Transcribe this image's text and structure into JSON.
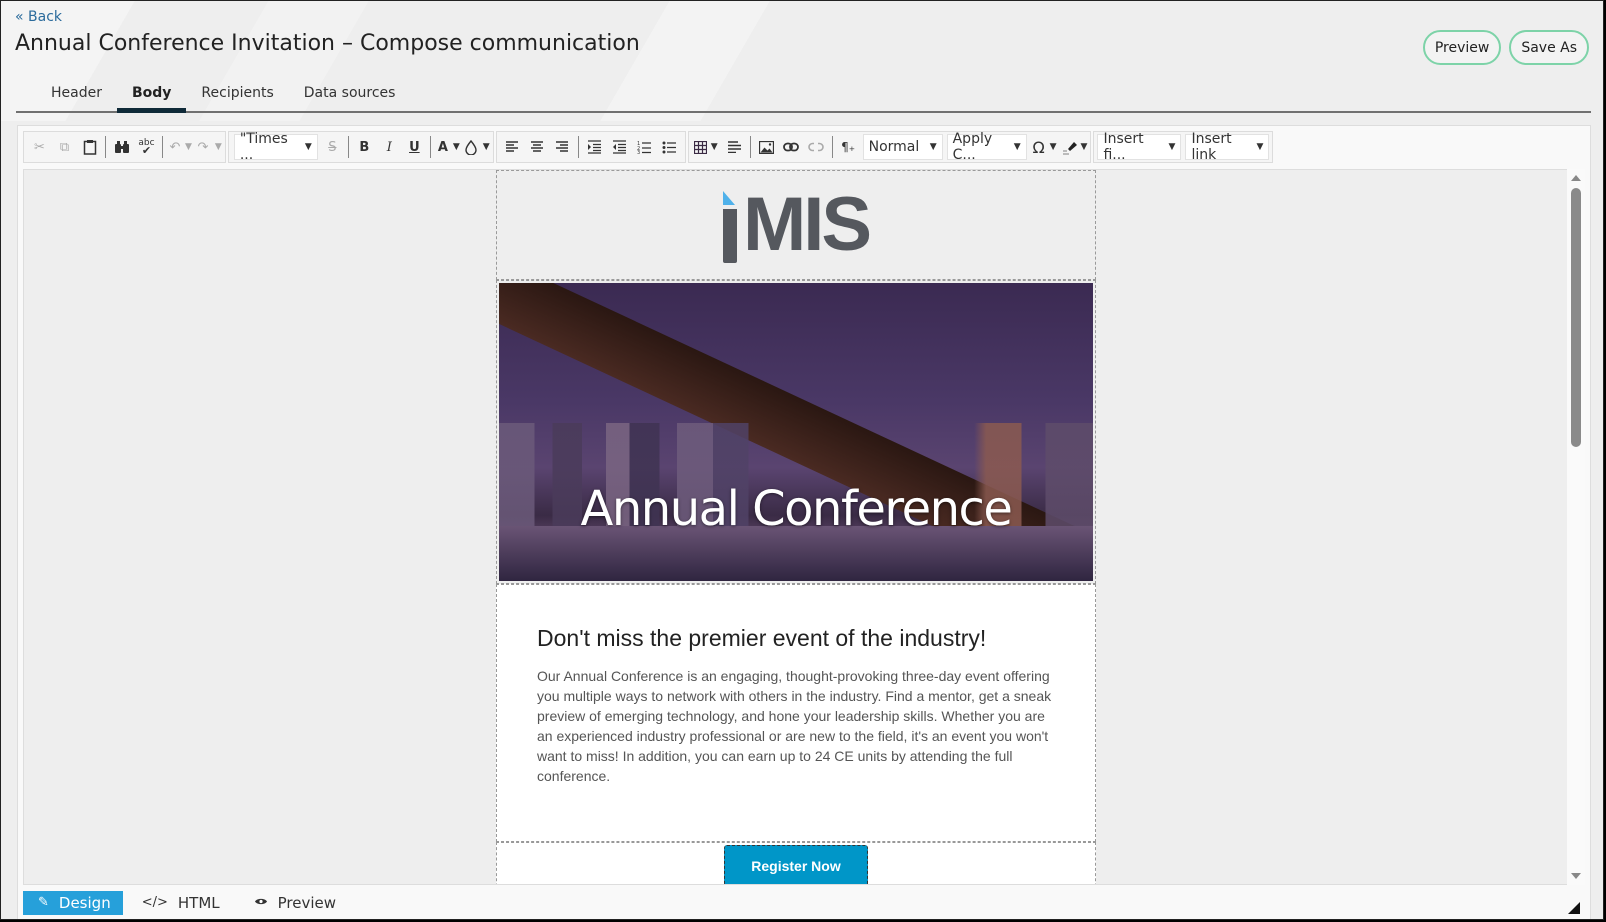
{
  "nav": {
    "back_label": "« Back"
  },
  "page": {
    "title": "Annual Conference Invitation – Compose communication"
  },
  "actions": {
    "preview_label": "Preview",
    "save_as_label": "Save As"
  },
  "tabs": [
    {
      "label": "Header",
      "active": false
    },
    {
      "label": "Body",
      "active": true
    },
    {
      "label": "Recipients",
      "active": false
    },
    {
      "label": "Data sources",
      "active": false
    }
  ],
  "toolbar": {
    "font_family": "\"Times ...",
    "paragraph_style": "Normal",
    "apply_css": "Apply C...",
    "insert_field": "Insert fi...",
    "insert_link": "Insert link",
    "icons": {
      "cut": "✂",
      "copy": "⧉",
      "paste": "📋",
      "find": "⌕",
      "spell": "abc✓",
      "undo": "↶",
      "redo": "↷",
      "strike": "S̶",
      "bold": "B",
      "italic": "I",
      "underline": "U",
      "fore_color": "A",
      "back_color": "◌",
      "align_left": "≡",
      "align_center": "≡",
      "align_right": "≡",
      "indent": "⇥",
      "outdent": "⇤",
      "ordered_list": "⒈",
      "bullet_list": "•≡",
      "table": "▦",
      "paragraph_props": "☰",
      "image": "▣",
      "link": "⊂⊃",
      "unlink": "⊄",
      "format_block": "¶₊",
      "symbol": "Ω",
      "format_stripper": "✎"
    }
  },
  "email": {
    "logo_text": "MIS",
    "logo_accent_color": "#4fb1ea",
    "hero_title": "Annual Conference",
    "heading": "Don't miss the premier event of the industry!",
    "body": "Our Annual Conference is an engaging, thought-provoking three-day event offering you multiple ways to network with others in the industry. Find a mentor, get a sneak preview of emerging technology, and hone your leadership skills. Whether you are an experienced industry professional or are new to the field, it's an event you won't want to miss! In addition, you can earn up to 24 CE units by attending the full conference.",
    "cta_label": "Register Now",
    "cta_color": "#0096c8"
  },
  "modes": [
    {
      "label": "Design",
      "icon": "✎",
      "active": true
    },
    {
      "label": "HTML",
      "icon": "</>",
      "active": false
    },
    {
      "label": "Preview",
      "icon": "👁",
      "active": false
    }
  ],
  "colors": {
    "accent": "#26a0da",
    "pill_border": "#7dd3a8"
  }
}
